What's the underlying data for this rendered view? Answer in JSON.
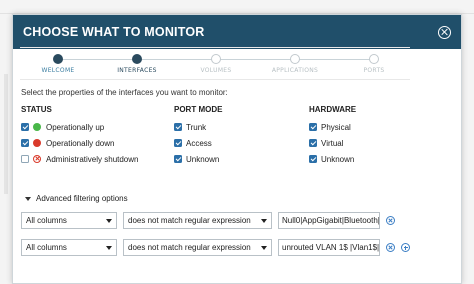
{
  "dialog": {
    "title": "CHOOSE WHAT TO MONITOR"
  },
  "wizard": {
    "steps": [
      {
        "label": "WELCOME",
        "state": "done"
      },
      {
        "label": "INTERFACES",
        "state": "active"
      },
      {
        "label": "VOLUMES",
        "state": "todo"
      },
      {
        "label": "APPLICATIONS",
        "state": "todo"
      },
      {
        "label": "PORTS",
        "state": "todo"
      }
    ]
  },
  "instruction": "Select the properties of the interfaces you want to monitor:",
  "status": {
    "heading": "STATUS",
    "items": [
      {
        "label": "Operationally up",
        "checked": true,
        "icon": "status-up-icon"
      },
      {
        "label": "Operationally down",
        "checked": true,
        "icon": "status-down-icon"
      },
      {
        "label": "Administratively shutdown",
        "checked": false,
        "icon": "status-shutdown-icon"
      }
    ]
  },
  "port_mode": {
    "heading": "PORT MODE",
    "items": [
      {
        "label": "Trunk",
        "checked": true
      },
      {
        "label": "Access",
        "checked": true
      },
      {
        "label": "Unknown",
        "checked": true
      }
    ]
  },
  "hardware": {
    "heading": "HARDWARE",
    "items": [
      {
        "label": "Physical",
        "checked": true
      },
      {
        "label": "Virtual",
        "checked": true
      },
      {
        "label": "Unknown",
        "checked": true
      }
    ]
  },
  "advanced": {
    "label": "Advanced filtering options",
    "filters": [
      {
        "column": "All columns",
        "operator": "does not match regular expression",
        "value": "Null0|AppGigabit|Bluetooth|",
        "add": false
      },
      {
        "column": "All columns",
        "operator": "does not match regular expression",
        "value": "unrouted VLAN 1$ |Vlan1$|",
        "add": true
      }
    ]
  },
  "colors": {
    "header_bg": "#204f6a",
    "accent": "#2b6fa8",
    "status_up": "#49b749",
    "status_down": "#d93a2b"
  }
}
